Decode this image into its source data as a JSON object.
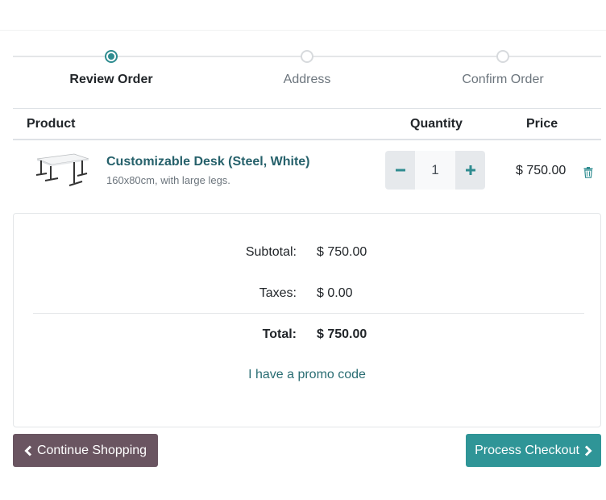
{
  "steps": [
    {
      "label": "Review Order",
      "active": true
    },
    {
      "label": "Address",
      "active": false
    },
    {
      "label": "Confirm Order",
      "active": false
    }
  ],
  "table": {
    "headers": {
      "product": "Product",
      "quantity": "Quantity",
      "price": "Price"
    },
    "rows": [
      {
        "name": "Customizable Desk (Steel, White)",
        "description": "160x80cm, with large legs.",
        "quantity": "1",
        "price": "$ 750.00",
        "image_icon": "desk-icon",
        "remove_icon": "trash-icon"
      }
    ]
  },
  "summary": {
    "subtotal_label": "Subtotal:",
    "subtotal_value": "$ 750.00",
    "taxes_label": "Taxes:",
    "taxes_value": "$ 0.00",
    "total_label": "Total:",
    "total_value": "$ 750.00",
    "promo_link": "I have a promo code"
  },
  "actions": {
    "continue_label": "Continue Shopping",
    "checkout_label": "Process Checkout"
  },
  "colors": {
    "accent": "#2f8c90",
    "link": "#26616b",
    "continue_bg": "#6a5561",
    "checkout_bg": "#2f9597"
  }
}
